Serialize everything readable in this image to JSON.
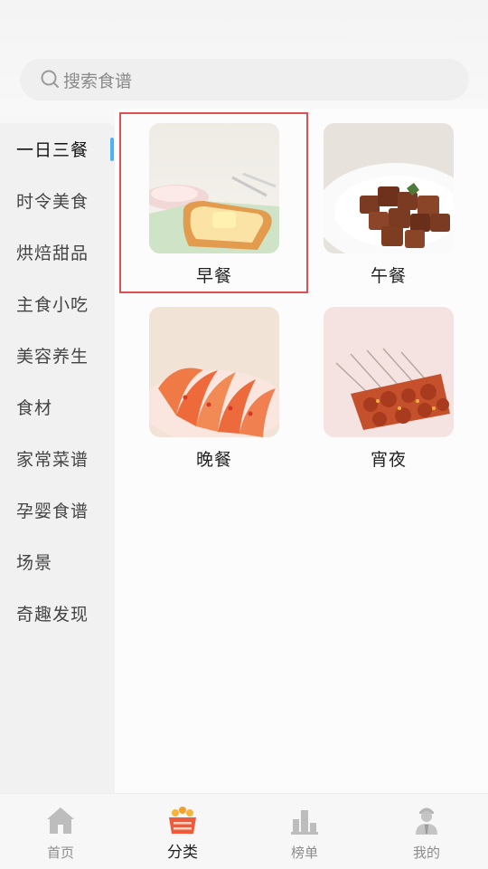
{
  "search": {
    "placeholder": "搜索食谱"
  },
  "sidebar": {
    "items": [
      {
        "label": "一日三餐",
        "active": true
      },
      {
        "label": "时令美食"
      },
      {
        "label": "烘焙甜品"
      },
      {
        "label": "主食小吃"
      },
      {
        "label": "美容养生"
      },
      {
        "label": "食材"
      },
      {
        "label": "家常菜谱"
      },
      {
        "label": "孕婴食谱"
      },
      {
        "label": "场景"
      },
      {
        "label": "奇趣发现"
      }
    ],
    "active_color": "#4fb2f2"
  },
  "categories": [
    {
      "label": "早餐",
      "image": "toast-breakfast",
      "selected": true
    },
    {
      "label": "午餐",
      "image": "braised-meat"
    },
    {
      "label": "晚餐",
      "image": "shrimp-plate"
    },
    {
      "label": "宵夜",
      "image": "bbq-skewers"
    }
  ],
  "tabbar": {
    "tabs": [
      {
        "label": "首页",
        "icon": "home-icon"
      },
      {
        "label": "分类",
        "icon": "basket-icon",
        "active": true
      },
      {
        "label": "榜单",
        "icon": "chart-icon"
      },
      {
        "label": "我的",
        "icon": "user-icon"
      }
    ]
  },
  "colors": {
    "selection_outline": "#e05050",
    "tab_active": "#f08040"
  }
}
